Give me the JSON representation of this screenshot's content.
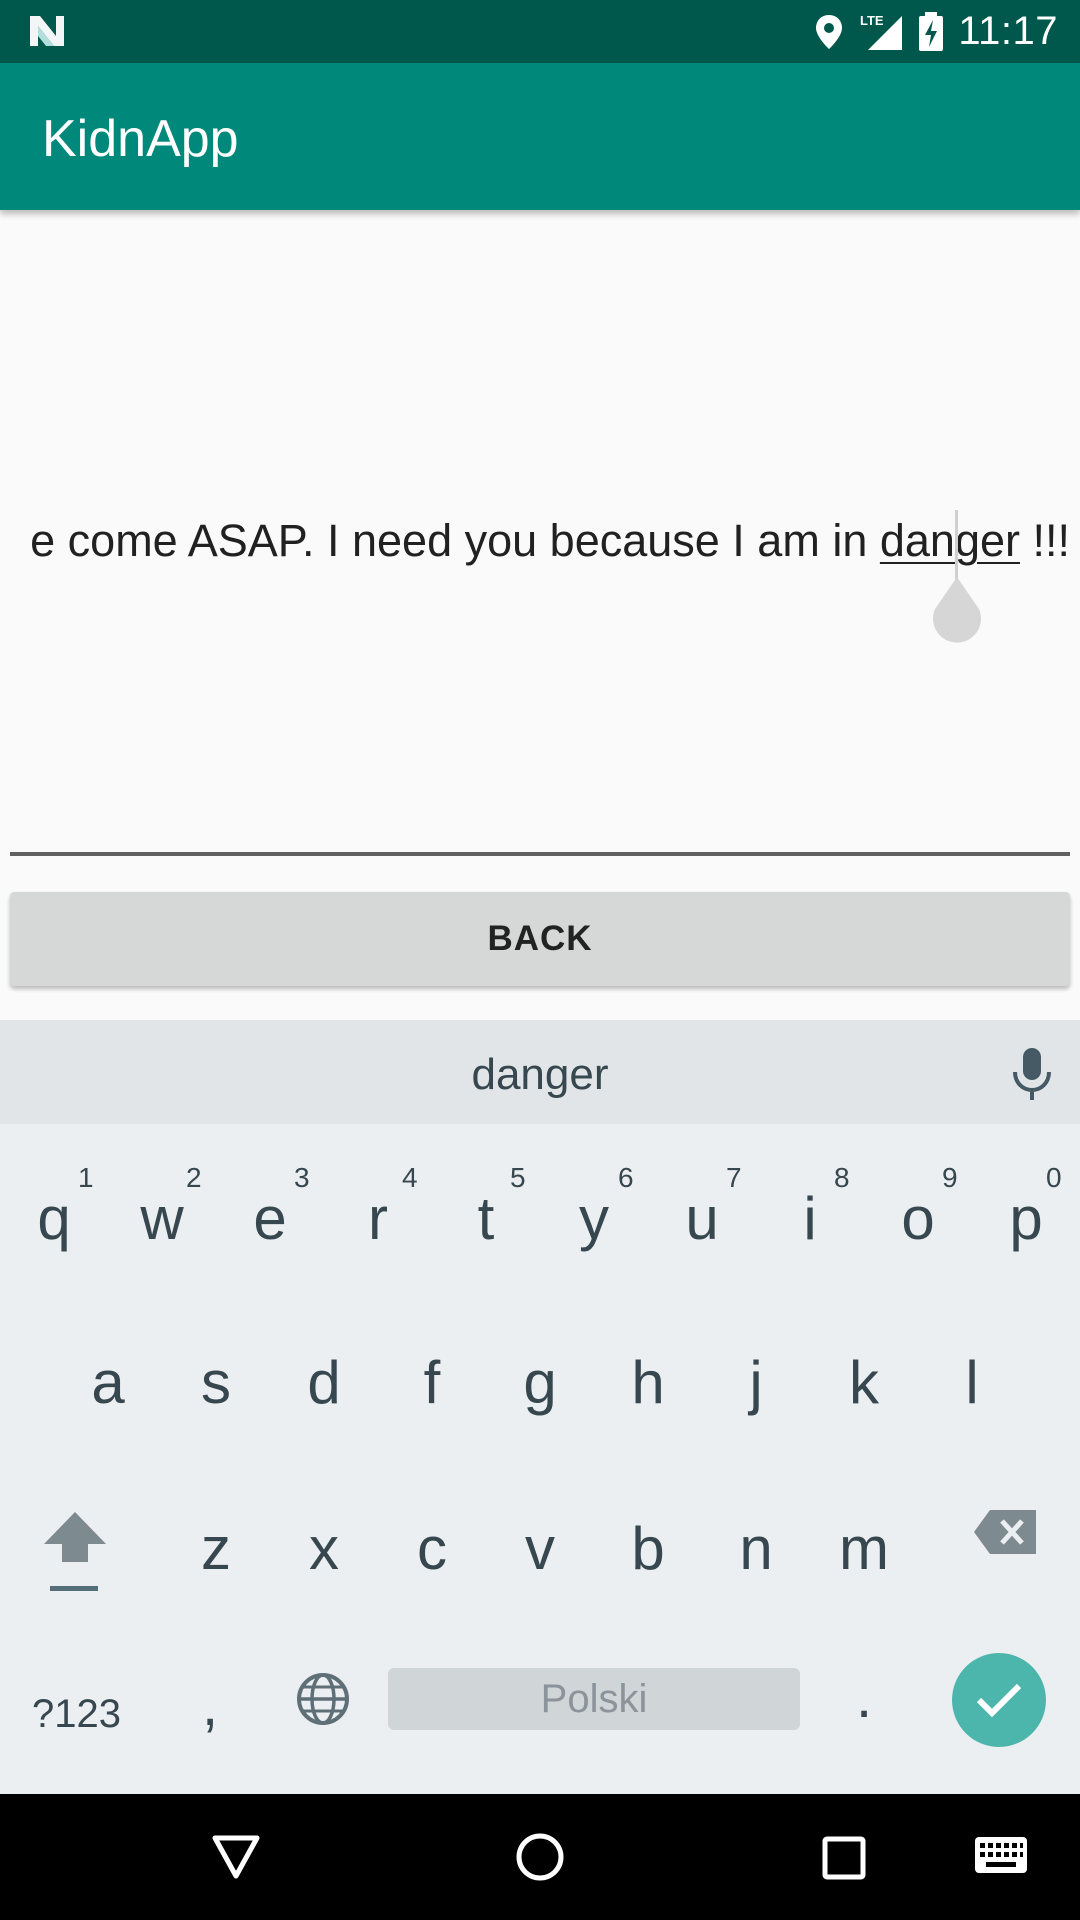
{
  "status_bar": {
    "time": "11:17",
    "network_label": "LTE",
    "icons": [
      "n-logo-icon",
      "location-icon",
      "signal-icon",
      "battery-charging-icon"
    ]
  },
  "app_bar": {
    "title": "KidnApp"
  },
  "message_input": {
    "text_before": "e come ASAP. I need you because I am in ",
    "composing_word": "danger",
    "text_after": " !!!"
  },
  "back_button": {
    "label": "BACK"
  },
  "keyboard": {
    "suggestion": "danger",
    "row1": [
      {
        "key": "q",
        "hint": "1"
      },
      {
        "key": "w",
        "hint": "2"
      },
      {
        "key": "e",
        "hint": "3"
      },
      {
        "key": "r",
        "hint": "4"
      },
      {
        "key": "t",
        "hint": "5"
      },
      {
        "key": "y",
        "hint": "6"
      },
      {
        "key": "u",
        "hint": "7"
      },
      {
        "key": "i",
        "hint": "8"
      },
      {
        "key": "o",
        "hint": "9"
      },
      {
        "key": "p",
        "hint": "0"
      }
    ],
    "row2": [
      "a",
      "s",
      "d",
      "f",
      "g",
      "h",
      "j",
      "k",
      "l"
    ],
    "row3": [
      "z",
      "x",
      "c",
      "v",
      "b",
      "n",
      "m"
    ],
    "symbols_label": "?123",
    "comma": ",",
    "space_label": "Polski",
    "period": ".",
    "accent_color": "#4db6ac"
  },
  "nav_bar": {
    "icons": [
      "back-triangle-icon",
      "home-circle-icon",
      "recents-square-icon",
      "keyboard-icon"
    ]
  }
}
